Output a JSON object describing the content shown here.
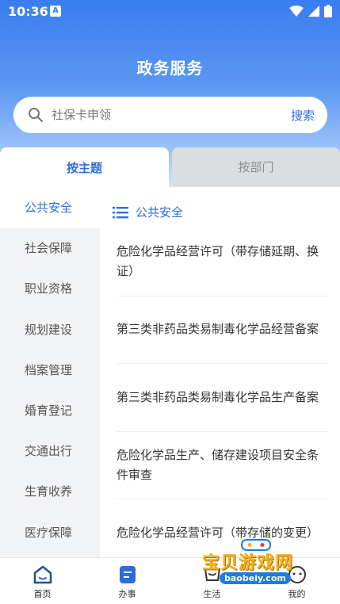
{
  "status_bar": {
    "time": "10:36",
    "notification_badge": "A"
  },
  "header": {
    "title": "政务服务"
  },
  "search": {
    "placeholder": "社保卡申领",
    "button_label": "搜索"
  },
  "tabs": [
    {
      "label": "按主题",
      "active": true
    },
    {
      "label": "按部门",
      "active": false
    }
  ],
  "sidebar": {
    "items": [
      {
        "label": "公共安全",
        "active": true
      },
      {
        "label": "社会保障"
      },
      {
        "label": "职业资格"
      },
      {
        "label": "规划建设"
      },
      {
        "label": "档案管理"
      },
      {
        "label": "婚育登记"
      },
      {
        "label": "交通出行"
      },
      {
        "label": "生育收养"
      },
      {
        "label": "医疗保障"
      }
    ]
  },
  "content": {
    "category_title": "公共安全",
    "items": [
      "危险化学品经营许可（带存储延期、换证）",
      "第三类非药品类易制毒化学品经营备案",
      "第三类非药品类易制毒化学品生产备案",
      "危险化学品生产、储存建设项目安全条件审查",
      "危险化学品经营许可（带存储的变更）"
    ]
  },
  "bottom_nav": [
    {
      "label": "首页",
      "icon": "home-icon",
      "active": true
    },
    {
      "label": "办事",
      "icon": "service-icon"
    },
    {
      "label": "生活",
      "icon": "life-icon"
    },
    {
      "label": "我的",
      "icon": "profile-icon"
    }
  ],
  "watermark": {
    "text": "宝贝游戏网",
    "url": "baobeiy.com"
  },
  "colors": {
    "accent": "#2d6be0",
    "header_top": "#3a7df0",
    "sidebar_bg": "#f2f3f5"
  }
}
